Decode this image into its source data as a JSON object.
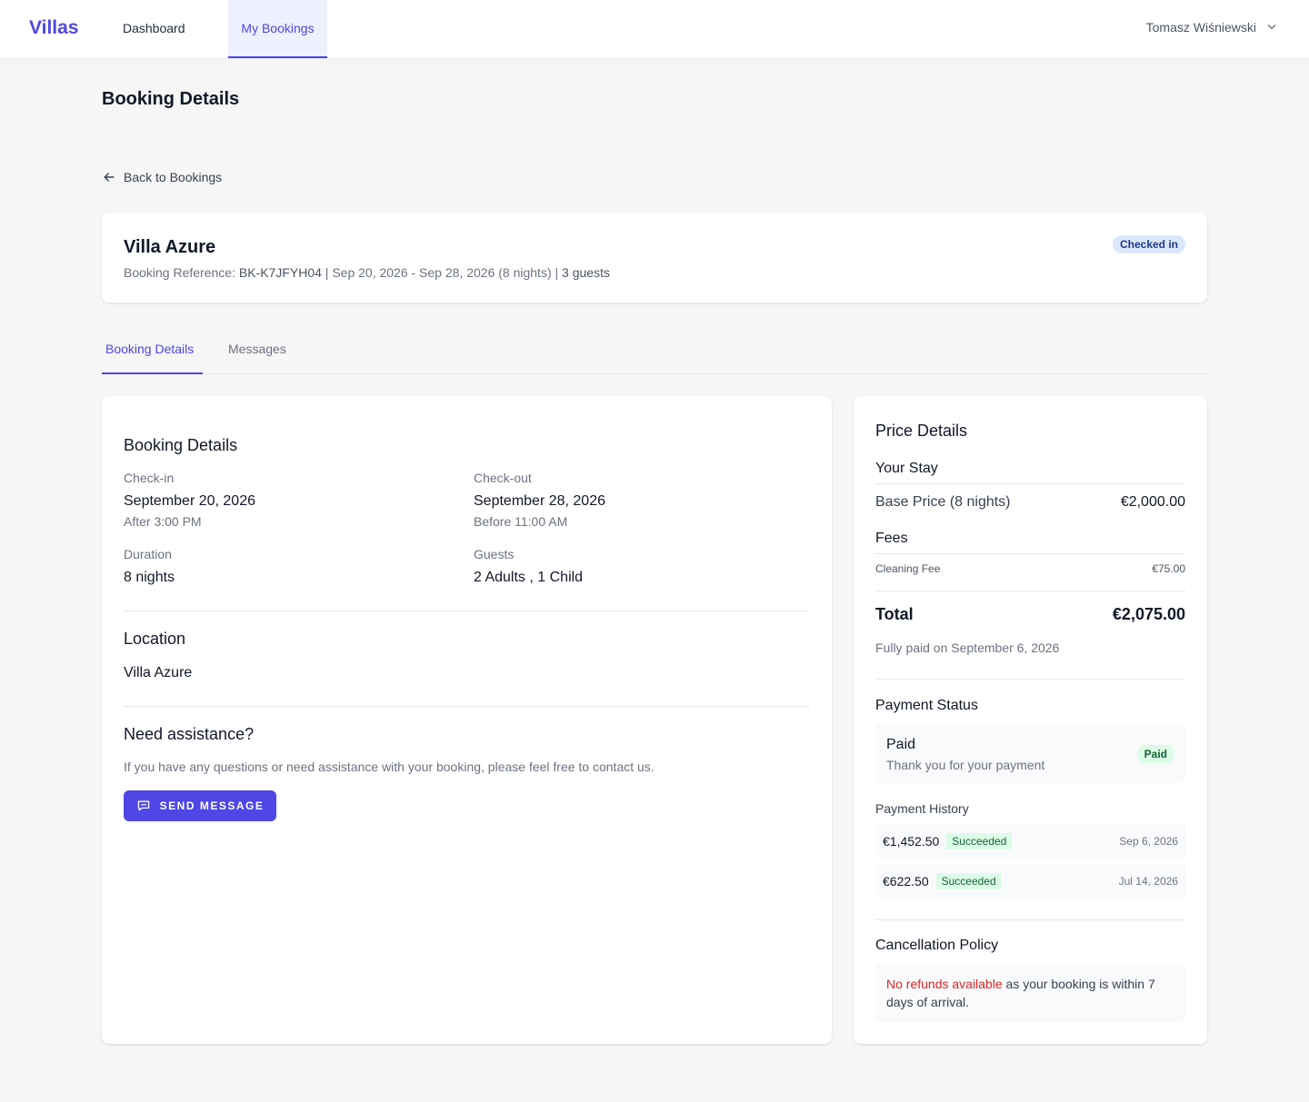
{
  "nav": {
    "brand": "Villas",
    "links": [
      "Dashboard",
      "My Bookings"
    ],
    "user_name": "Tomasz Wiśniewski"
  },
  "page": {
    "title": "Booking Details",
    "back_label": "Back to Bookings"
  },
  "booking": {
    "villa_name": "Villa Azure",
    "reference_label": "Booking Reference: ",
    "reference": "BK-K7JFYH04",
    "date_range": " | Sep 20, 2026 - Sep 28, 2026 (8 nights) | ",
    "guests_summary": "3 guests",
    "status": "Checked in"
  },
  "tabs": [
    "Booking Details",
    "Messages"
  ],
  "details": {
    "title": "Booking Details",
    "checkin_label": "Check-in",
    "checkin_date": "September 20, 2026",
    "checkin_time": "After 3:00 PM",
    "checkout_label": "Check-out",
    "checkout_date": "September 28, 2026",
    "checkout_time": "Before 11:00 AM",
    "duration_label": "Duration",
    "duration_value": "8 nights",
    "guests_label": "Guests",
    "guests_value": "2 Adults , 1 Child",
    "location_title": "Location",
    "location_value": "Villa Azure",
    "assist_title": "Need assistance?",
    "assist_text": "If you have any questions or need assistance with your booking, please feel free to contact us.",
    "send_button": "SEND MESSAGE"
  },
  "price": {
    "title": "Price Details",
    "stay_heading": "Your Stay",
    "base_label": "Base Price (8 nights)",
    "base_value": "€2,000.00",
    "fees_heading": "Fees",
    "cleaning_label": "Cleaning Fee",
    "cleaning_value": "€75.00",
    "total_label": "Total",
    "total_value": "€2,075.00",
    "paid_note": "Fully paid on September 6, 2026",
    "status_title": "Payment Status",
    "status_value": "Paid",
    "status_sub": "Thank you for your payment",
    "status_badge": "Paid",
    "history_title": "Payment History",
    "history": [
      {
        "amount": "€1,452.50",
        "status": "Succeeded",
        "date": "Sep 6, 2026"
      },
      {
        "amount": "€622.50",
        "status": "Succeeded",
        "date": "Jul 14, 2026"
      }
    ],
    "policy_title": "Cancellation Policy",
    "policy_highlight": "No refunds available",
    "policy_text": " as your booking is within 7 days of arrival."
  },
  "colors": {
    "accent": "#4f46e5",
    "success": "#166534",
    "danger": "#dc2626"
  }
}
